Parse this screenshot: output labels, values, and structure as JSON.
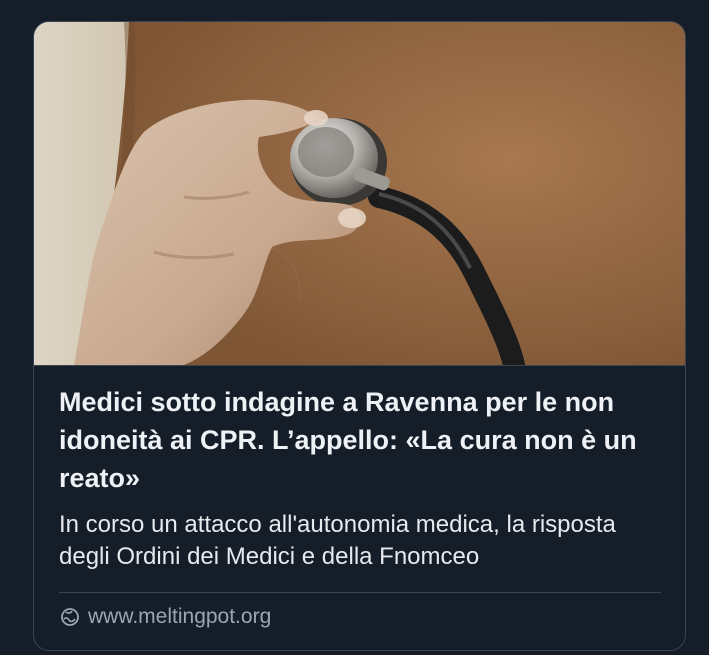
{
  "card": {
    "image_alt": "A hand holding a stethoscope against a patient's back",
    "headline": "Medici sotto indagine a Ravenna per le non idoneità ai CPR. L’appello: «La cura non è un reato»",
    "summary": "In corso un attacco all'autonomia medica, la risposta degli Ordini dei Medici e della Fnomceo",
    "source": {
      "icon": "link-globe-icon",
      "domain": "www.meltingpot.org"
    }
  },
  "colors": {
    "background": "#151d28",
    "border": "#3a4554",
    "headline": "#eef1f5",
    "summary": "#e6e9ee",
    "source": "#9ba6b3"
  }
}
